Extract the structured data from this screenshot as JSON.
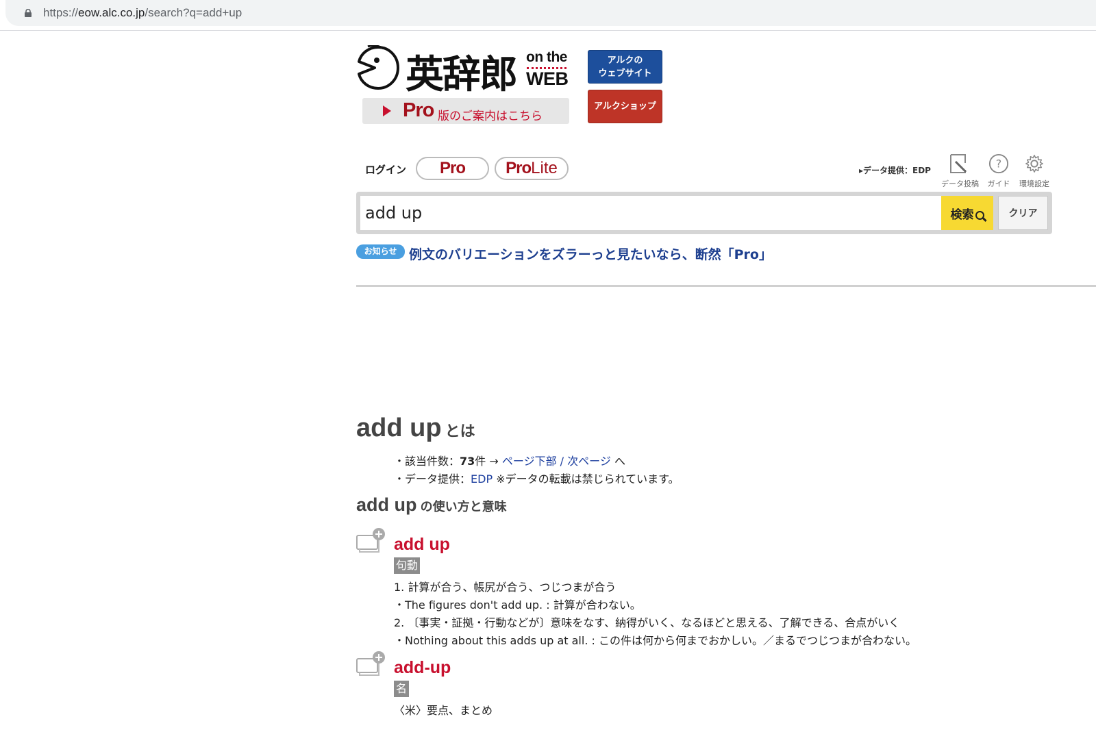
{
  "browser": {
    "url_scheme": "https://",
    "url_host": "eow.alc.co.jp",
    "url_path": "/search?q=add+up"
  },
  "logo": {
    "title": "英辞郎",
    "on_the": "on the",
    "web": "WEB"
  },
  "pro_banner": {
    "pro": "Pro",
    "rest": "版のご案内はこちら"
  },
  "alc_links": {
    "website_line1": "アルクの",
    "website_line2": "ウェブサイト",
    "shop": "アルクショップ"
  },
  "account": {
    "login": "ログイン",
    "pro": "Pro",
    "prolite_a": "Pro",
    "prolite_b": "Lite"
  },
  "tools": {
    "data_source": "▸データ提供：EDP",
    "post_label": "データ投稿",
    "guide_label": "ガイド",
    "settings_label": "環境設定"
  },
  "search": {
    "query": "add up",
    "search_button": "検索",
    "clear_button": "クリア"
  },
  "notice": {
    "badge": "お知らせ",
    "text": "例文のバリエーションをズラーっと見たいなら、断然「Pro」"
  },
  "result": {
    "term": "add up",
    "title_suffix": "とは",
    "count_prefix": "・該当件数：",
    "count": "73",
    "count_unit": "件",
    "arrow": "→",
    "page_bottom": "ページ下部",
    "slash": "/",
    "next_page": "次ページ",
    "to": "へ",
    "data_prefix": "・データ提供：",
    "data_provider": "EDP",
    "data_note": "※データの転載は禁じられています。",
    "usage_suffix": "の使い方と意味"
  },
  "entries": [
    {
      "headword": "add up",
      "pos": "句動",
      "lines": [
        "1. 計算が合う、帳尻が合う、つじつまが合う",
        "・The figures don't add up. : 計算が合わない。",
        "2. 〔事実・証拠・行動などが〕意味をなす、納得がいく、なるほどと思える、了解できる、合点がいく",
        "・Nothing about this adds up at all. : この件は何から何までおかしい。／まるでつじつまが合わない。"
      ]
    },
    {
      "headword": "add-up",
      "pos": "名",
      "lines": [
        "〈米〉要点、まとめ"
      ]
    }
  ]
}
